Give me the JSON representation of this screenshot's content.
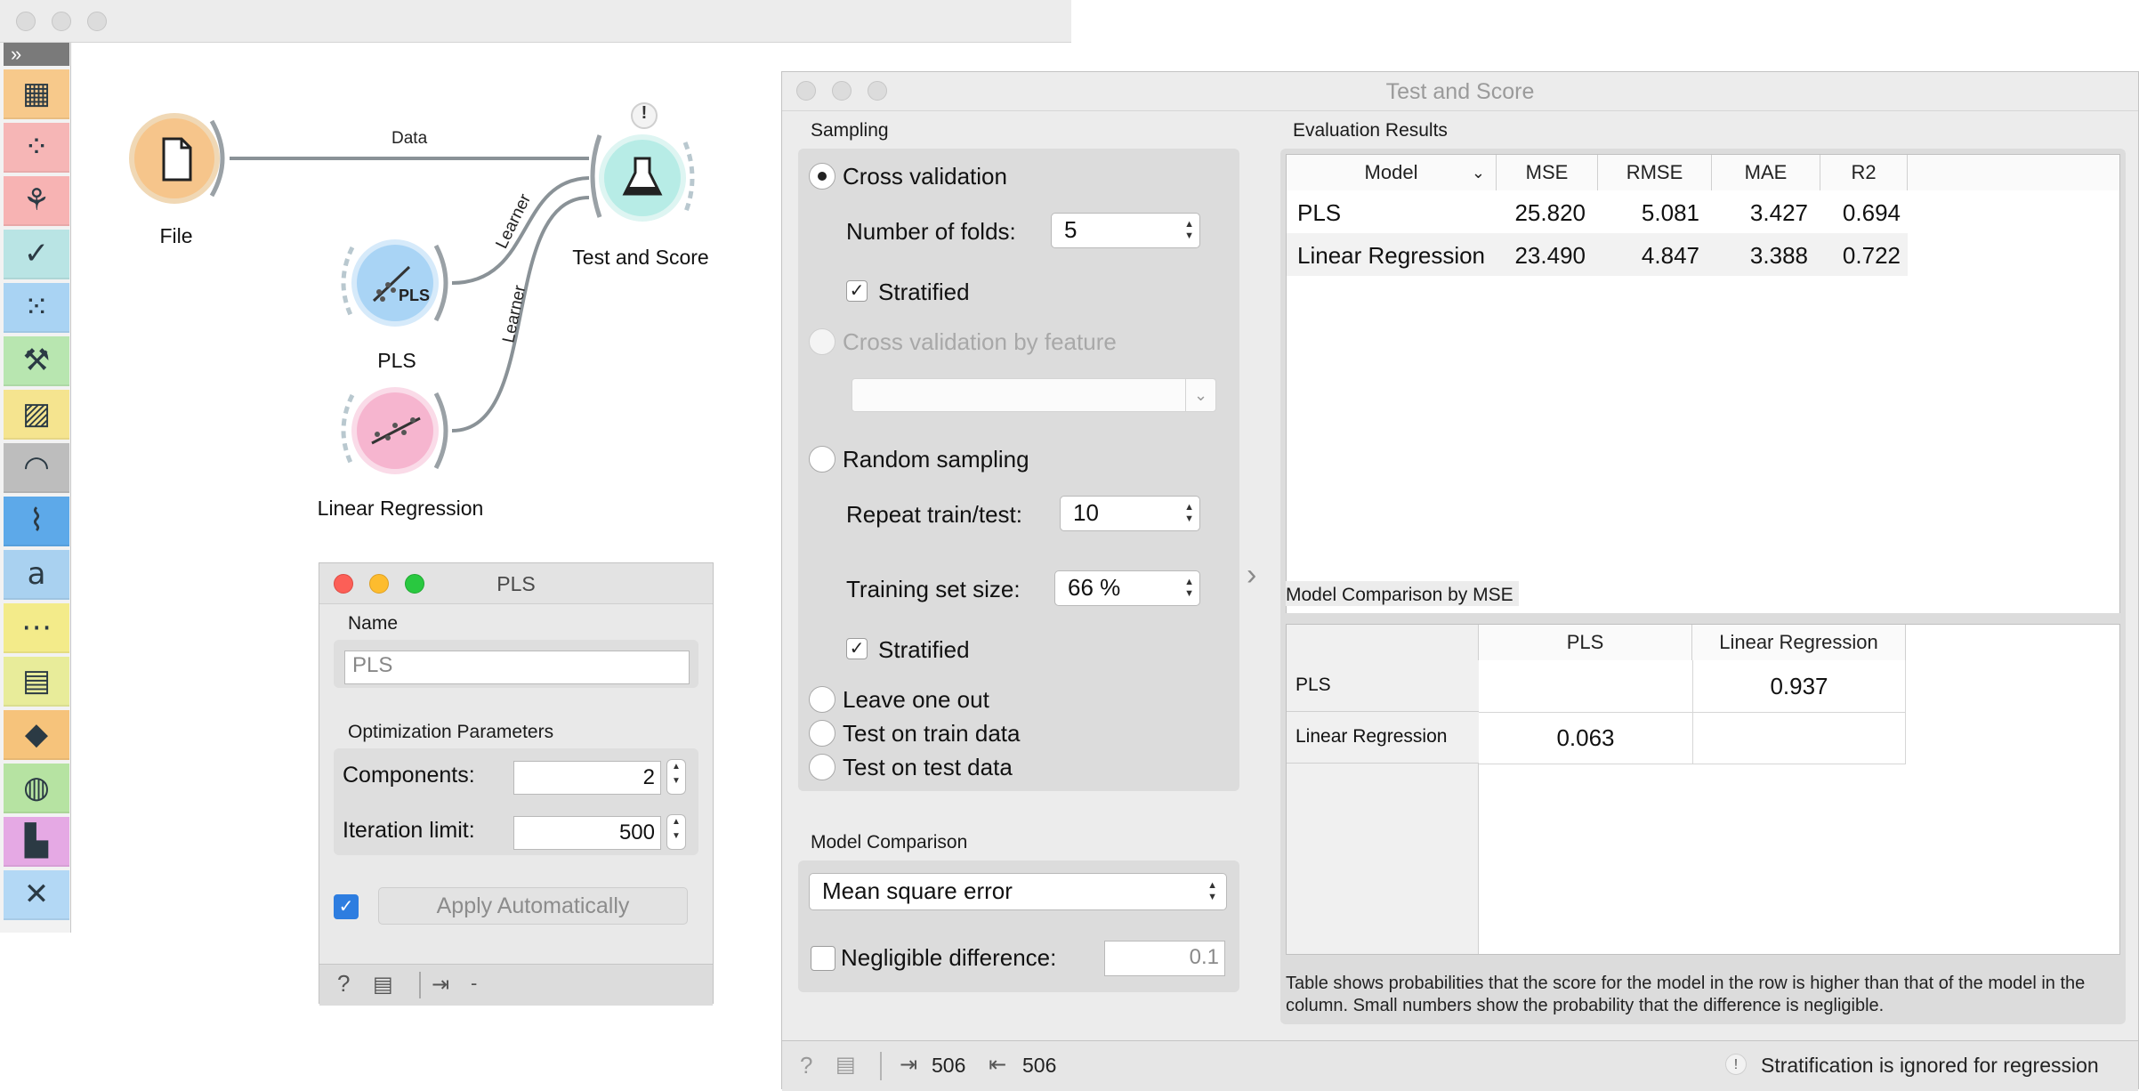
{
  "canvas": {
    "widgets": {
      "file": {
        "label": "File"
      },
      "pls": {
        "label": "PLS",
        "icon_text": "PLS"
      },
      "linear_regression": {
        "label": "Linear Regression"
      },
      "test_and_score": {
        "label": "Test and Score",
        "warning": "!"
      }
    },
    "links": {
      "data": "Data",
      "learner1": "Learner",
      "learner2": "Learner"
    },
    "toolbox": {
      "collapse_glyph": "»",
      "tile_colors": [
        "#f7c98b",
        "#f6b6b6",
        "#f7b3b3",
        "#b9e4e4",
        "#a9d3f3",
        "#b8e6b0",
        "#f5e48f",
        "#bdbdbd",
        "#5da9e9",
        "#a9d1f0",
        "#f3eb8a",
        "#e8ec9a",
        "#f6c37b",
        "#b6e3a2",
        "#e5a9e4",
        "#b3d8f5"
      ]
    }
  },
  "pls_dialog": {
    "title": "PLS",
    "name_label": "Name",
    "name_placeholder": "PLS",
    "optimization_label": "Optimization Parameters",
    "components_label": "Components:",
    "components_value": "2",
    "iteration_label": "Iteration limit:",
    "iteration_value": "500",
    "apply_checked": true,
    "apply_label": "Apply Automatically",
    "status_dash": "-"
  },
  "test_and_score": {
    "title": "Test and Score",
    "sampling": {
      "label": "Sampling",
      "selected": "cross_validation",
      "cross_validation": "Cross validation",
      "folds_label": "Number of folds:",
      "folds_value": "5",
      "stratified1": "Stratified",
      "cv_by_feature": "Cross validation by feature",
      "random_sampling": "Random sampling",
      "repeat_label": "Repeat train/test:",
      "repeat_value": "10",
      "training_size_label": "Training set size:",
      "training_size_value": "66 %",
      "stratified2": "Stratified",
      "leave_one_out": "Leave one out",
      "test_on_train": "Test on train data",
      "test_on_test": "Test on test data"
    },
    "model_comparison": {
      "label": "Model Comparison",
      "metric": "Mean square error",
      "negligible_label": "Negligible difference:",
      "negligible_value": "0.1"
    },
    "evaluation": {
      "label": "Evaluation Results",
      "columns": [
        "Model",
        "MSE",
        "RMSE",
        "MAE",
        "R2"
      ],
      "rows": [
        [
          "PLS",
          "25.820",
          "5.081",
          "3.427",
          "0.694"
        ],
        [
          "Linear Regression",
          "23.490",
          "4.847",
          "3.388",
          "0.722"
        ]
      ]
    },
    "comparison": {
      "label": "Model Comparison by MSE",
      "columns": [
        "PLS",
        "Linear Regression"
      ],
      "row_labels": [
        "PLS",
        "Linear Regression"
      ],
      "values": [
        [
          "",
          "0.937"
        ],
        [
          "0.063",
          ""
        ]
      ],
      "note": "Table shows probabilities that the score for the model in the row is higher than that of the model in the column. Small numbers show the probability that the difference is negligible."
    },
    "status": {
      "input_count": "506",
      "output_count": "506",
      "warning": "Stratification is ignored for regression"
    }
  }
}
